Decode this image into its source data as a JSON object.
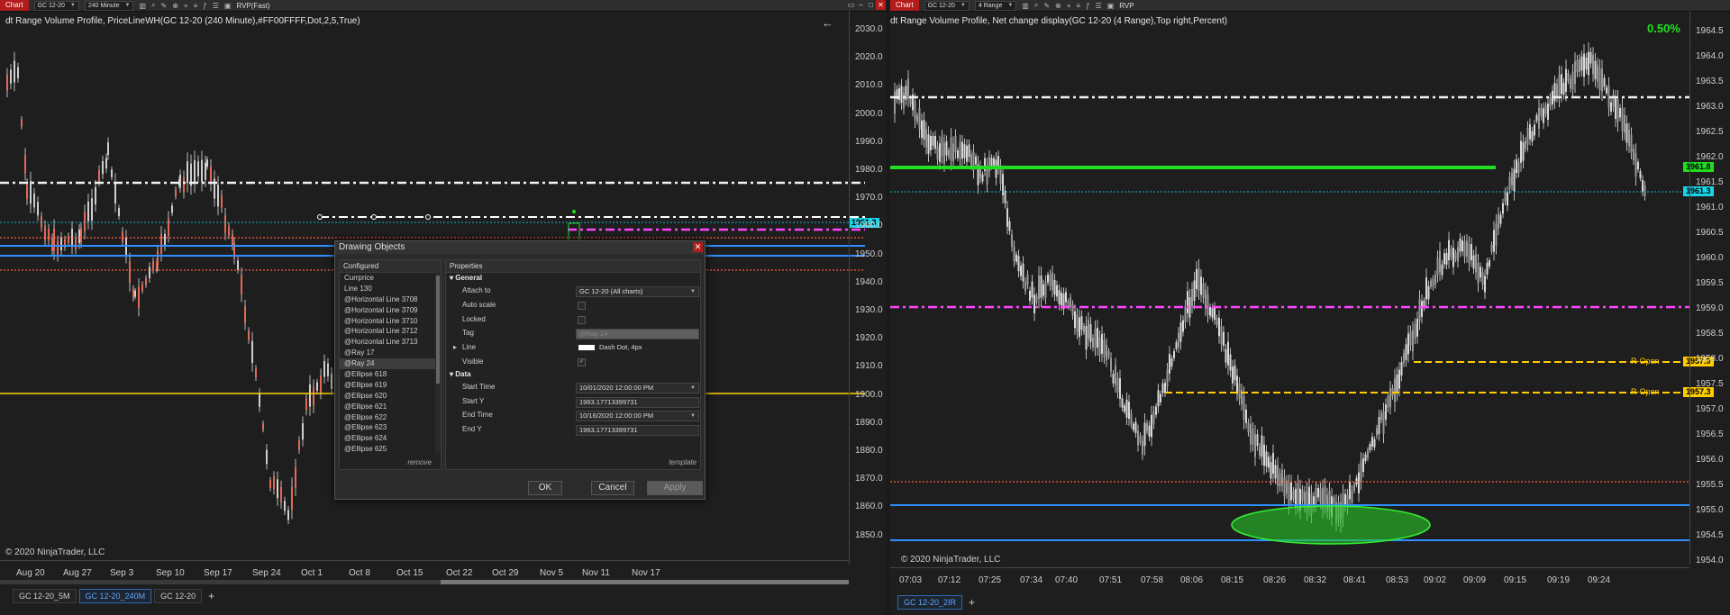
{
  "left": {
    "toolbar": {
      "chart_label": "Chart",
      "instrument": "GC 12-20",
      "interval": "240 Minute",
      "indicator": "RVP(Fast)"
    },
    "chart_title": "dt Range Volume Profile, PriceLineWH(GC 12-20 (240 Minute),#FF00FFFF,Dot,2,5,True)",
    "copyright": "© 2020 NinjaTrader, LLC",
    "price_tag": "1961.3",
    "y_ticks": [
      "2030.0",
      "2020.0",
      "2010.0",
      "2000.0",
      "1990.0",
      "1980.0",
      "1970.0",
      "1960.0",
      "1950.0",
      "1940.0",
      "1930.0",
      "1920.0",
      "1910.0",
      "1900.0",
      "1890.0",
      "1880.0",
      "1870.0",
      "1860.0",
      "1850.0"
    ],
    "x_ticks": [
      "Aug 20",
      "Aug 27",
      "Sep 3",
      "Sep 10",
      "Sep 17",
      "Sep 24",
      "Oct 1",
      "Oct 8",
      "Oct 15",
      "Oct 22",
      "Oct 29",
      "Nov 5",
      "Nov 11",
      "Nov 17"
    ],
    "tabs": [
      {
        "label": "GC 12-20_5M",
        "active": false
      },
      {
        "label": "GC 12-20_240M",
        "active": true
      },
      {
        "label": "GC 12-20",
        "active": false
      }
    ],
    "tab_plus": "+"
  },
  "right": {
    "toolbar": {
      "chart_label": "Chart",
      "instrument": "GC 12-20",
      "interval": "4 Range",
      "indicator": "RVP"
    },
    "chart_title": "dt Range Volume Profile, Net change display(GC 12-20 (4 Range),Top right,Percent)",
    "copyright": "© 2020 NinjaTrader, LLC",
    "net_change": "0.50%",
    "price_tags": {
      "green": "1961.8",
      "cyan": "1961.3",
      "yellow_a": "1957.9",
      "yellow_b": "1957.3"
    },
    "ropen_label": "R-Open",
    "y_ticks": [
      "1964.5",
      "1964.0",
      "1963.5",
      "1963.0",
      "1962.5",
      "1962.0",
      "1961.5",
      "1961.0",
      "1960.5",
      "1960.0",
      "1959.5",
      "1959.0",
      "1958.5",
      "1958.0",
      "1957.5",
      "1957.0",
      "1956.5",
      "1956.0",
      "1955.5",
      "1955.0",
      "1954.5",
      "1954.0"
    ],
    "x_ticks": [
      "07:03",
      "07:12",
      "07:25",
      "07:34",
      "07:40",
      "07:51",
      "07:58",
      "08:06",
      "08:15",
      "08:26",
      "08:32",
      "08:41",
      "08:53",
      "09:02",
      "09:09",
      "09:15",
      "09:19",
      "09:24"
    ],
    "tabs": [
      {
        "label": "GC 12-20_2IR",
        "active": true
      }
    ],
    "tab_plus": "+"
  },
  "dialog": {
    "title": "Drawing Objects",
    "left_header": "Configured",
    "items": [
      "Currprice",
      "Line 130",
      "@Horizontal Line 3708",
      "@Horizontal Line 3709",
      "@Horizontal Line 3710",
      "@Horizontal Line 3712",
      "@Horizontal Line 3713",
      "@Ray 17",
      "@Ray 24",
      "@Ellipse 618",
      "@Ellipse 619",
      "@Ellipse 620",
      "@Ellipse 621",
      "@Ellipse 622",
      "@Ellipse 623",
      "@Ellipse 624",
      "@Ellipse 625"
    ],
    "selected_item": "@Ray 24",
    "remove_label": "remove",
    "right_header": "Properties",
    "general_label": "General",
    "data_label": "Data",
    "props": {
      "attach_to": {
        "label": "Attach to",
        "value": "GC 12-20 (All charts)"
      },
      "auto_scale": {
        "label": "Auto scale"
      },
      "locked": {
        "label": "Locked"
      },
      "tag": {
        "label": "Tag",
        "value": "@Ray 24"
      },
      "line": {
        "label": "Line",
        "value": "Dash Dot, 4px"
      },
      "visible": {
        "label": "Visible",
        "check": "✓"
      },
      "start_time": {
        "label": "Start Time",
        "value": "10/01/2020 12:00:00 PM"
      },
      "start_y": {
        "label": "Start Y",
        "value": "1963.17713399731"
      },
      "end_time": {
        "label": "End Time",
        "value": "10/16/2020 12:00:00 PM"
      },
      "end_y": {
        "label": "End Y",
        "value": "1963.17713399731"
      }
    },
    "template_label": "template",
    "ok_label": "OK",
    "cancel_label": "Cancel",
    "apply_label": "Apply"
  }
}
